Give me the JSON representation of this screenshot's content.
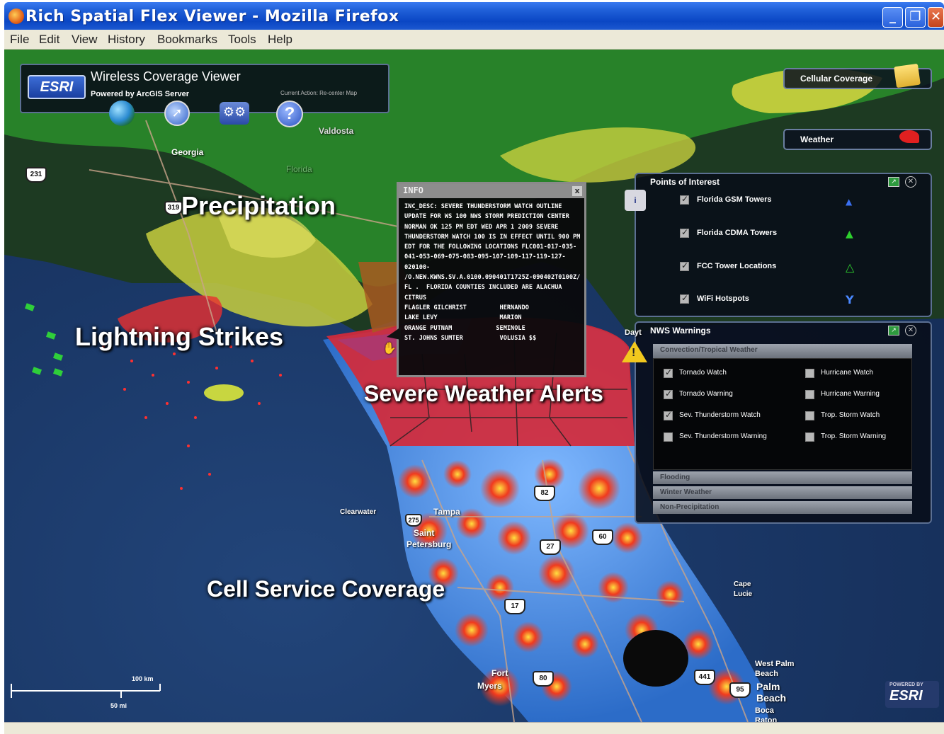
{
  "window": {
    "title": "Rich Spatial Flex Viewer - Mozilla Firefox",
    "minimize": "_",
    "maximize": "❐",
    "close": "✕"
  },
  "menu": [
    "File",
    "Edit",
    "View",
    "History",
    "Bookmarks",
    "Tools",
    "Help"
  ],
  "app": {
    "logo": "ESRI",
    "title": "Wireless Coverage Viewer",
    "subtitle": "Powered by ArcGIS Server",
    "current_action": "Current Action: Re-center Map",
    "toolbar_icons": [
      "globe-icon",
      "compass-icon",
      "gears-icon",
      "help-icon"
    ],
    "help_glyph": "?"
  },
  "right_buttons": {
    "cellular": "Cellular Coverage",
    "weather": "Weather"
  },
  "points_of_interest": {
    "title": "Points of Interest",
    "items": [
      {
        "label": "Florida GSM Towers",
        "checked": true
      },
      {
        "label": "Florida CDMA Towers",
        "checked": true
      },
      {
        "label": "FCC Tower Locations",
        "checked": true
      },
      {
        "label": "WiFi Hotspots",
        "checked": true
      }
    ]
  },
  "nws_warnings": {
    "title": "NWS Warnings",
    "section": "Convection/Tropical Weather",
    "left_items": [
      {
        "label": "Tornado Watch",
        "checked": true
      },
      {
        "label": "Tornado Warning",
        "checked": true
      },
      {
        "label": "Sev. Thunderstorm Watch",
        "checked": true
      },
      {
        "label": "Sev. Thunderstorm Warning",
        "checked": false
      }
    ],
    "right_items": [
      {
        "label": "Hurricane Watch",
        "checked": false
      },
      {
        "label": "Hurricane Warning",
        "checked": false
      },
      {
        "label": "Trop. Storm Watch",
        "checked": false
      },
      {
        "label": "Trop. Storm Warning",
        "checked": false
      }
    ],
    "collapsed_sections": [
      "Flooding",
      "Winter Weather",
      "Non-Precipitation"
    ]
  },
  "info_popup": {
    "title": "INFO",
    "close": "x",
    "body": "INC_DESC: SEVERE THUNDERSTORM WATCH OUTLINE UPDATE FOR WS 100 NWS STORM PREDICTION CENTER NORMAN OK 125 PM EDT WED APR 1 2009 SEVERE THUNDERSTORM WATCH 100 IS IN EFFECT UNTIL 900 PM EDT FOR THE FOLLOWING LOCATIONS FLC001-017-035-041-053-069-075-083-095-107-109-117-119-127-020100-\n/O.NEW.KWNS.SV.A.0100.090401T1725Z-090402T0100Z/ FL .  FLORIDA COUNTIES INCLUDED ARE ALACHUA           CITRUS\nFLAGLER GILCHRIST         HERNANDO\nLAKE LEVY                 MARION\nORANGE PUTNAM            SEMINOLE\nST. JOHNS SUMTER          VOLUSIA $$"
  },
  "overlay_labels": {
    "precipitation": "Precipitation",
    "lightning": "Lightning Strikes",
    "severe": "Severe Weather Alerts",
    "cell": "Cell Service Coverage"
  },
  "map_labels": {
    "georgia": "Georgia",
    "valdosta": "Valdosta",
    "clearwater": "Clearwater",
    "tampa": "Tampa",
    "saint": "Saint",
    "petersburg": "Petersburg",
    "fort": "Fort",
    "myers": "Myers",
    "west_palm": "West Palm",
    "beach": "Beach",
    "palm": "Palm",
    "palm_beach": "Beach",
    "boca": "Boca",
    "raton": "Raton",
    "florida": "Florida",
    "daytona": "Dayt",
    "cape": "Cape",
    "lucie": "Lucie"
  },
  "shields": [
    "231",
    "319",
    "82",
    "27",
    "60",
    "17",
    "80",
    "441",
    "95",
    "275"
  ],
  "scale": {
    "km": "100 km",
    "mi": "50 mi"
  },
  "esri_footer": {
    "top": "POWERED BY",
    "logo": "ESRI"
  },
  "colors": {
    "titlebar": "#0a46c4",
    "panel_bg": "#080c18",
    "panel_border": "#5b6f92",
    "precip_green": "#2faa2a",
    "precip_yellow": "#d8d840",
    "alert_red": "#e0282a",
    "alert_magenta": "#a03070",
    "coverage_blue": "#3a7fd0",
    "coverage_red": "#e43a22"
  }
}
